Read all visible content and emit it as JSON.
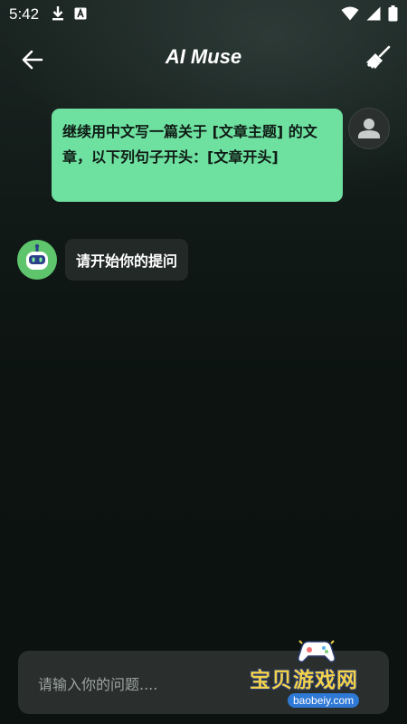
{
  "status_bar": {
    "time": "5:42",
    "left_icons": [
      "download-icon",
      "a-notification-icon"
    ],
    "right_icons": [
      "wifi-icon",
      "signal-icon",
      "battery-icon"
    ]
  },
  "app_bar": {
    "title": "AI Muse",
    "back_icon": "arrow-left-icon",
    "clear_icon": "broom-icon"
  },
  "messages": [
    {
      "role": "user",
      "text": "继续用中文写一篇关于 [文章主题] 的文章，以下列句子开头：[文章开头]"
    },
    {
      "role": "bot",
      "text": "请开始你的提问"
    }
  ],
  "input": {
    "placeholder": "请输入你的问题....",
    "value": ""
  },
  "watermark": {
    "title": "宝贝游戏网",
    "url": "baobeiy.com"
  },
  "colors": {
    "background": "#0c1311",
    "user_bubble": "#6ee0a0",
    "bot_bubble": "#232927",
    "bot_avatar": "#5ec56d",
    "input_bar": "#2a2f2e"
  }
}
